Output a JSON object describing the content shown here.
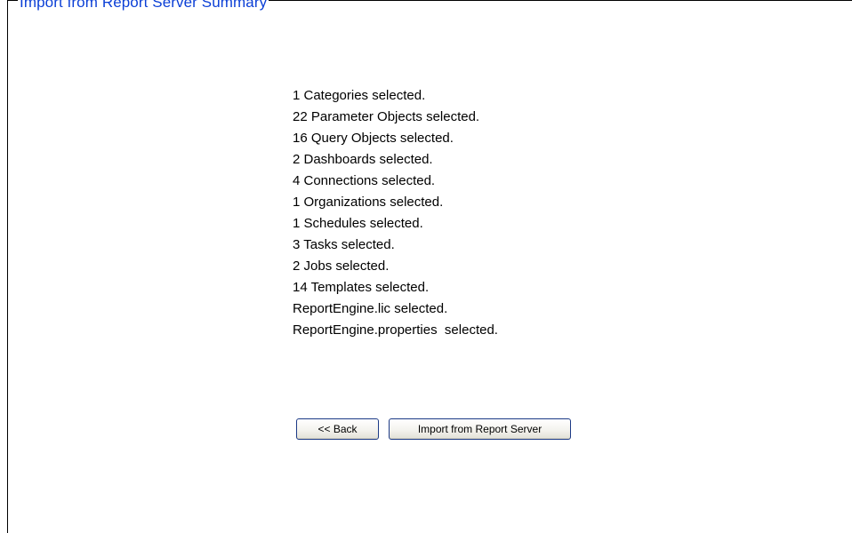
{
  "panel": {
    "title": "Import from Report Server Summary"
  },
  "summary": {
    "items": [
      "1 Categories selected.",
      "22 Parameter Objects selected.",
      "16 Query Objects selected.",
      "2 Dashboards selected.",
      "4 Connections selected.",
      "1 Organizations selected.",
      "1 Schedules selected.",
      "3 Tasks selected.",
      "2 Jobs selected.",
      "14 Templates selected.",
      "ReportEngine.lic selected.",
      "ReportEngine.properties  selected."
    ]
  },
  "buttons": {
    "back_label": "<< Back",
    "import_label": "Import from Report Server"
  },
  "colors": {
    "title": "#0b3fd6",
    "button_border": "#1c3a86"
  }
}
